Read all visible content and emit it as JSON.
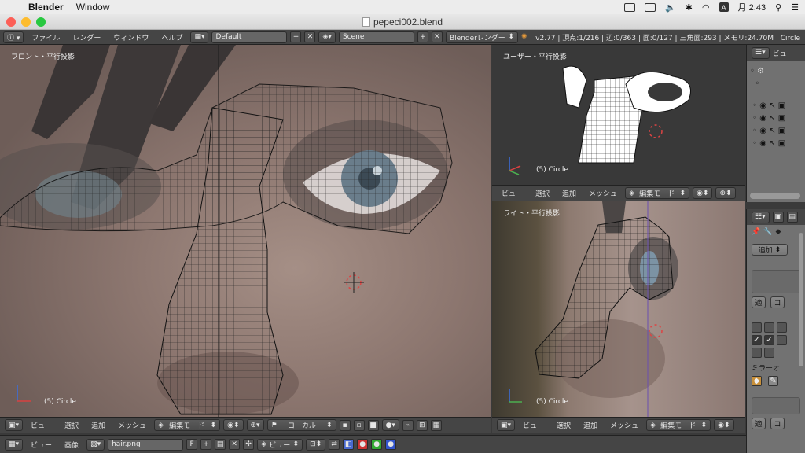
{
  "macos": {
    "app_name": "Blender",
    "menu": [
      "Window"
    ],
    "status_a": "A",
    "clock": "月 2:43"
  },
  "window": {
    "title": "pepeci002.blend"
  },
  "info_header": {
    "menus": [
      "ファイル",
      "レンダー",
      "ウィンドウ",
      "ヘルプ"
    ],
    "layout": "Default",
    "scene": "Scene",
    "engine": "Blenderレンダー",
    "stats": "v2.77 | 頂点:1/216 | 辺:0/363 | 面:0/127 | 三角面:293 | メモリ:24.70M | Circle"
  },
  "viewports": {
    "front": {
      "label": "フロント・平行投影",
      "object": "(5) Circle",
      "menus": [
        "ビュー",
        "選択",
        "追加",
        "メッシュ"
      ],
      "mode": "編集モード",
      "pivot": "ローカル"
    },
    "user": {
      "label": "ユーザー・平行投影",
      "object": "(5) Circle",
      "menus": [
        "ビュー",
        "選択",
        "追加",
        "メッシュ"
      ],
      "mode": "編集モード"
    },
    "right": {
      "label": "ライト・平行投影",
      "object": "(5) Circle",
      "menus": [
        "ビュー",
        "選択",
        "追加",
        "メッシュ"
      ],
      "mode": "編集モード"
    }
  },
  "outliner": {
    "view_label": "ビュー"
  },
  "properties": {
    "add_label": "追加",
    "apply_label": "適",
    "copy_label": "コ",
    "mirror_label": "ミラーオ",
    "apply_label_2": "適",
    "copy_label_2": "コ"
  },
  "uv_header": {
    "menus": [
      "ビュー",
      "画像"
    ],
    "image_name": "hair.png",
    "fake_user": "F",
    "view_label": "ビュー"
  }
}
